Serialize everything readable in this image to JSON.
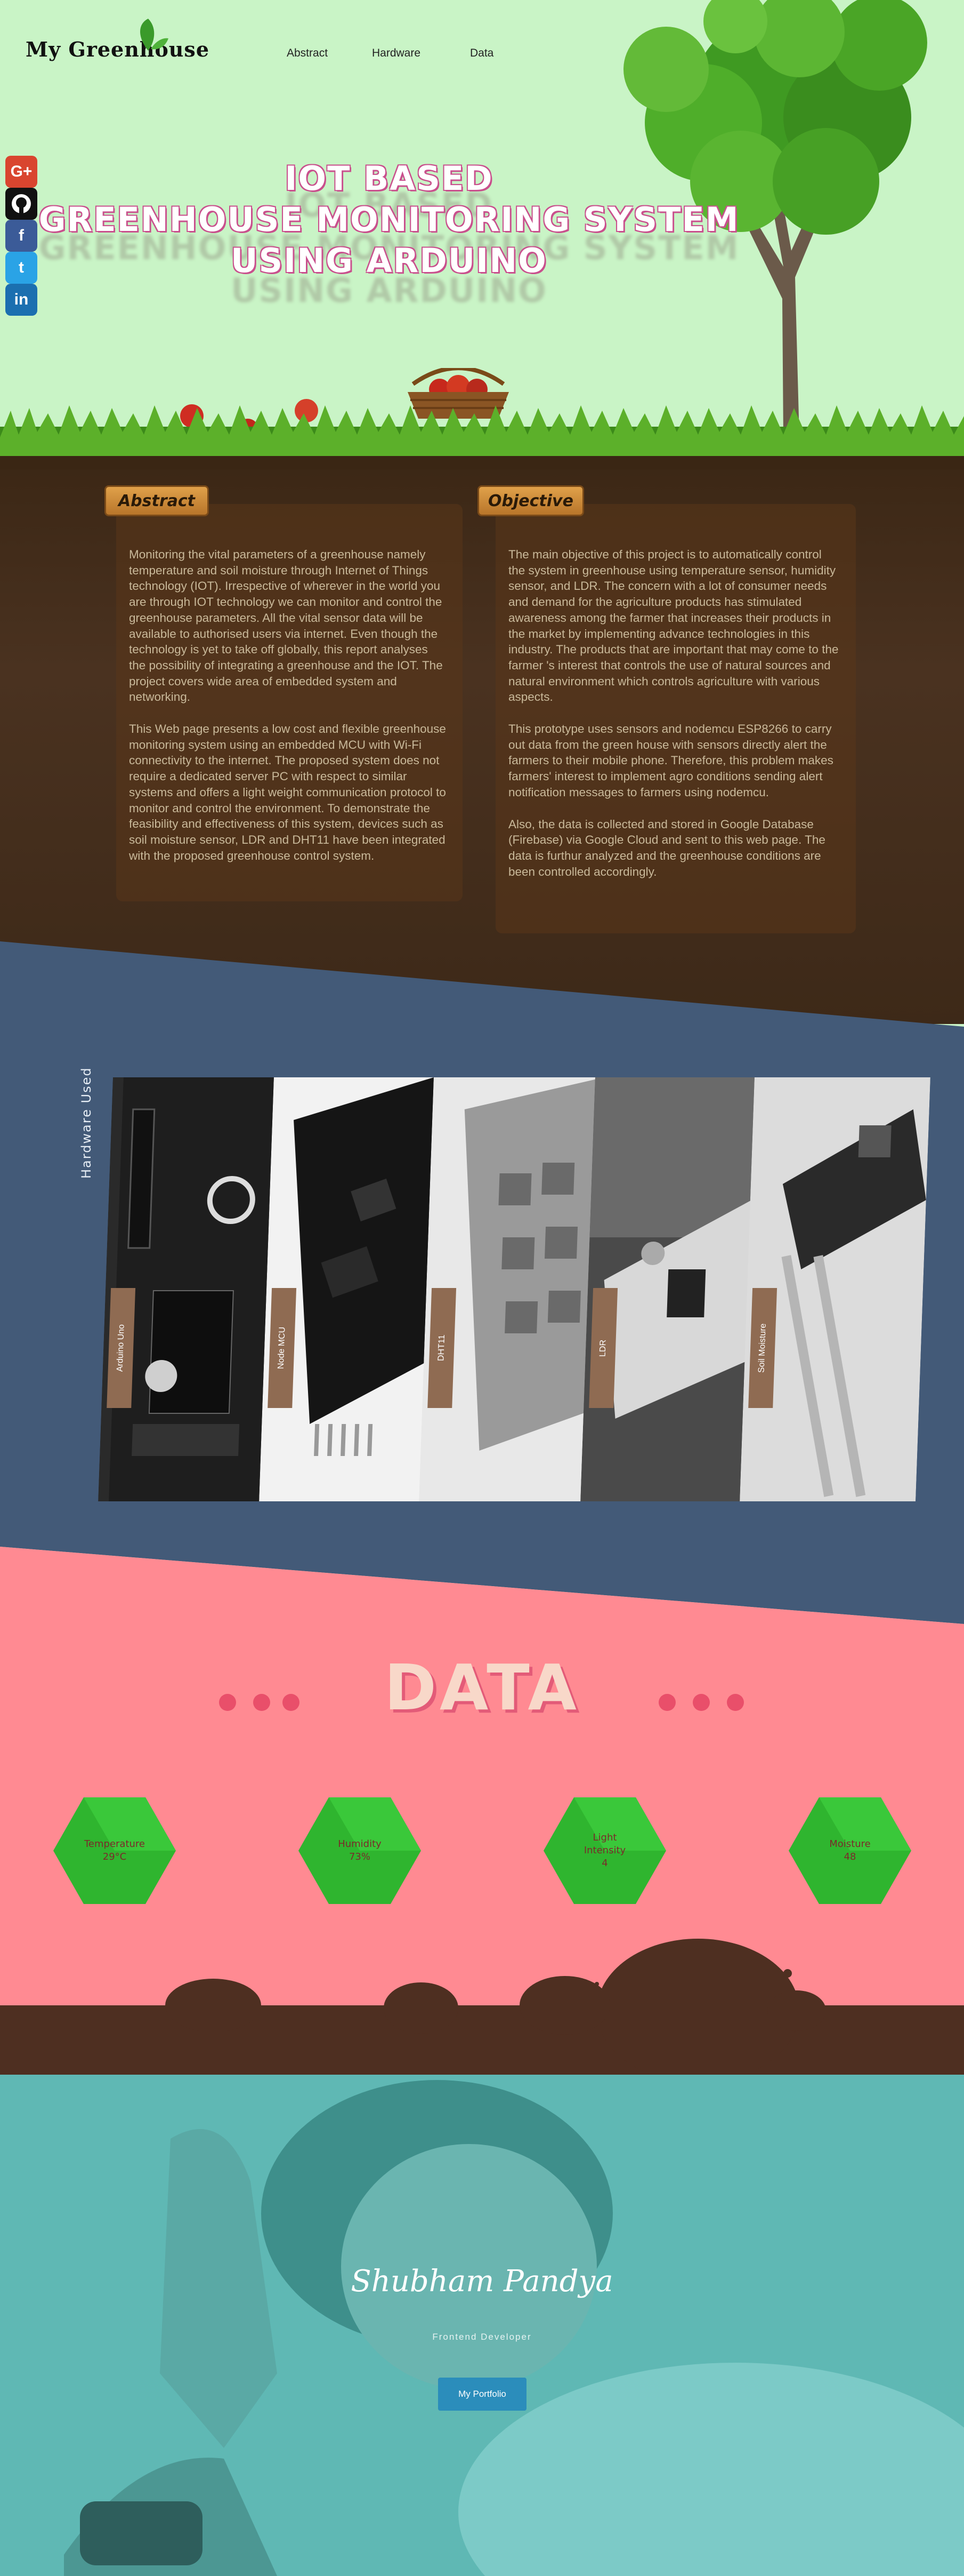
{
  "brand": {
    "name": "My Greenhouse"
  },
  "nav": {
    "items": [
      "Abstract",
      "Hardware",
      "Data"
    ]
  },
  "social": {
    "items": [
      "google-plus-icon",
      "github-icon",
      "facebook-icon",
      "twitter-icon",
      "linkedin-icon"
    ],
    "glyphs": [
      "G+",
      "",
      "f",
      "t",
      "in"
    ]
  },
  "hero": {
    "lines": [
      "IOT BASED",
      "GREENHOUSE MONITORING SYSTEM",
      "USING ARDUINO"
    ]
  },
  "abstract": {
    "heading": "Abstract",
    "paragraphs": [
      "Monitoring the vital parameters of a greenhouse namely temperature and soil moisture through Internet of Things technology (IOT). Irrespective of wherever in the world you are through IOT technology we can monitor and control the greenhouse parameters. All the vital sensor data will be available to authorised users via internet. Even though the technology is yet to take off globally, this report analyses the possibility of integrating a greenhouse and the IOT. The project covers wide area of embedded system and networking.",
      "This Web page presents a low cost and flexible greenhouse monitoring system using an embedded MCU with Wi-Fi connectivity to the internet. The proposed system does not require a dedicated server PC with respect to similar systems and offers a light weight communication protocol to monitor and control the environment. To demonstrate the feasibility and effectiveness of this system, devices such as soil moisture sensor, LDR and DHT11 have been integrated with the proposed greenhouse control system."
    ]
  },
  "objective": {
    "heading": "Objective",
    "paragraphs": [
      "The main objective of this project is to automatically control the system in greenhouse using temperature sensor, humidity sensor, and LDR. The concern with a lot of consumer needs and demand for the agriculture products has stimulated awareness among the farmer that increases their products in the market by implementing advance technologies in this industry. The products that are important that may come to the farmer 's interest that controls the use of natural sources and natural environment which controls agriculture with various aspects.",
      "This prototype uses sensors and nodemcu ESP8266 to carry out data from the green house with sensors directly alert the farmers to their mobile phone. Therefore, this problem makes farmers' interest to implement agro conditions sending alert notification messages to farmers using nodemcu.",
      "Also, the data is collected and stored in Google Database (Firebase) via Google Cloud and sent to this web page. The data is furthur analyzed and the greenhouse conditions are been controlled accordingly."
    ]
  },
  "hardware": {
    "section_label": "Hardware Used",
    "items": [
      "Arduino Uno",
      "Node MCU",
      "DHT11",
      "LDR",
      "Soil Moisture"
    ]
  },
  "data": {
    "title": "DATA",
    "readings": [
      {
        "label": "Temperature",
        "value": "29°C"
      },
      {
        "label": "Humidity",
        "value": "73%"
      },
      {
        "label": "Light Intensity",
        "value": "4"
      },
      {
        "label": "Moisture",
        "value": "48"
      }
    ]
  },
  "profile": {
    "name": "Shubham Pandya",
    "role": "Frontend Developer",
    "button": "My Portfolio"
  },
  "colors": {
    "hero_bg": "#c9f4c6",
    "hardware_bg": "#435a78",
    "data_bg": "#ff8a92",
    "hex_green": "#2fb52f",
    "soil": "#4a3220",
    "profile_bg": "#5fb8b4",
    "accent_pink": "#c9508d"
  }
}
